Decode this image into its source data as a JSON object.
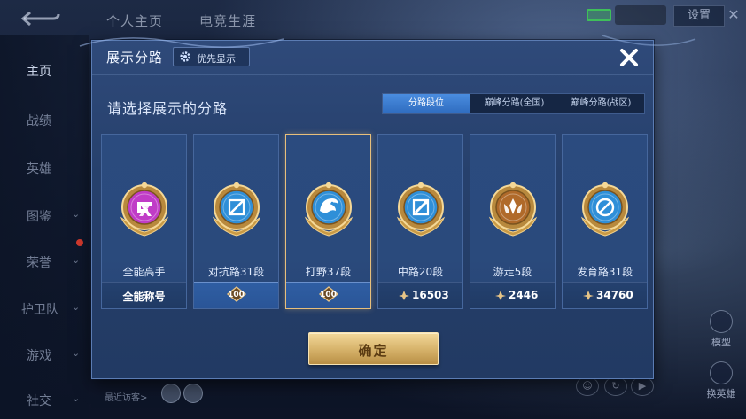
{
  "background": {
    "top_tabs": [
      "个人主页",
      "电竞生涯"
    ],
    "settings_label": "设置",
    "sidebar": [
      {
        "label": "主页",
        "active": true
      },
      {
        "label": "战绩"
      },
      {
        "label": "英雄"
      },
      {
        "label": "图鉴",
        "chevron": true
      },
      {
        "label": "荣誉",
        "chevron": true,
        "dot": true
      },
      {
        "label": "护卫队",
        "chevron": true
      },
      {
        "label": "游戏",
        "chevron": true
      },
      {
        "label": "社交",
        "chevron": true
      }
    ],
    "recent_visitors_label": "最近访客>",
    "right_utils": [
      "模型",
      "换英雄"
    ]
  },
  "modal": {
    "title": "展示分路",
    "priority_button_label": "优先显示",
    "prompt": "请选择展示的分路",
    "segments": [
      {
        "label": "分路段位",
        "active": true
      },
      {
        "label": "巅峰分路(全国)"
      },
      {
        "label": "巅峰分路(战区)"
      }
    ],
    "cards": [
      {
        "rank": "全能高手",
        "footer_type": "text",
        "footer_text": "全能称号",
        "badge_color": "#c03cc7",
        "glyph": "all"
      },
      {
        "rank": "对抗路31段",
        "footer_type": "star",
        "footer_text": "100",
        "badge_color": "#2f8fd8",
        "glyph": "sword"
      },
      {
        "rank": "打野37段",
        "footer_type": "star",
        "footer_text": "100",
        "badge_color": "#2f8fd8",
        "glyph": "dragon",
        "selected": true
      },
      {
        "rank": "中路20段",
        "footer_type": "points",
        "footer_text": "16503",
        "badge_color": "#2f8fd8",
        "glyph": "staff"
      },
      {
        "rank": "游走5段",
        "footer_type": "points",
        "footer_text": "2446",
        "badge_color": "#b06a2a",
        "glyph": "support"
      },
      {
        "rank": "发育路31段",
        "footer_type": "points",
        "footer_text": "34760",
        "badge_color": "#2f8fd8",
        "glyph": "bow"
      }
    ],
    "confirm_label": "确定"
  },
  "colors": {
    "accent_blue": "#3a7fd6",
    "gold": "#e7bf7c",
    "panel": "#26406c"
  }
}
